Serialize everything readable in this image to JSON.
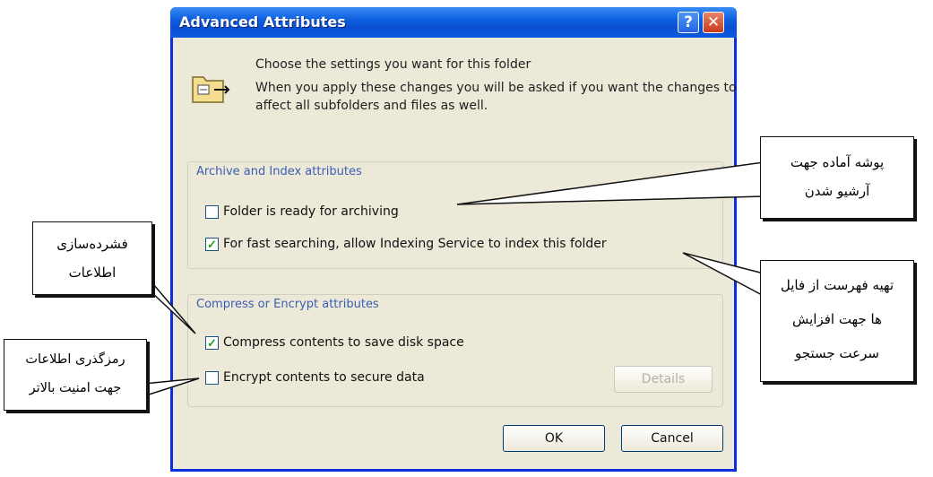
{
  "dialog": {
    "title": "Advanced Attributes",
    "help_symbol": "?",
    "close_symbol": "✕",
    "intro_line1": "Choose the settings you want for this folder",
    "intro_line2": "When you apply these changes you will be asked if you want the changes to affect all subfolders and files as well.",
    "group1": {
      "title": "Archive and Index attributes",
      "options": [
        {
          "label": "Folder is ready for archiving",
          "checked": false
        },
        {
          "label": "For fast searching, allow Indexing Service to index this folder",
          "checked": true
        }
      ]
    },
    "group2": {
      "title": "Compress or Encrypt attributes",
      "options": [
        {
          "label": "Compress contents to save disk space",
          "checked": true
        },
        {
          "label": "Encrypt contents to secure data",
          "checked": false
        }
      ],
      "details_label": "Details"
    },
    "ok_label": "OK",
    "cancel_label": "Cancel",
    "check_mark": "✓"
  },
  "callouts": {
    "archive_line1": "پوشه آماده جهت",
    "archive_line2": "آرشیو شدن",
    "index_line1": "تهیه فهرست از فایل",
    "index_line2": "ها جهت افزایش",
    "index_line3": "سرعت جستجو",
    "compress_line1": "فشرده‌سازی",
    "compress_line2": "اطلاعات",
    "encrypt_line1": "رمزگذری اطلاعات",
    "encrypt_line2": "جهت امنیت بالاتر"
  },
  "colors": {
    "titlebar": "#0a4fd0",
    "group_title": "#3a5eb5",
    "check": "#21a121"
  }
}
